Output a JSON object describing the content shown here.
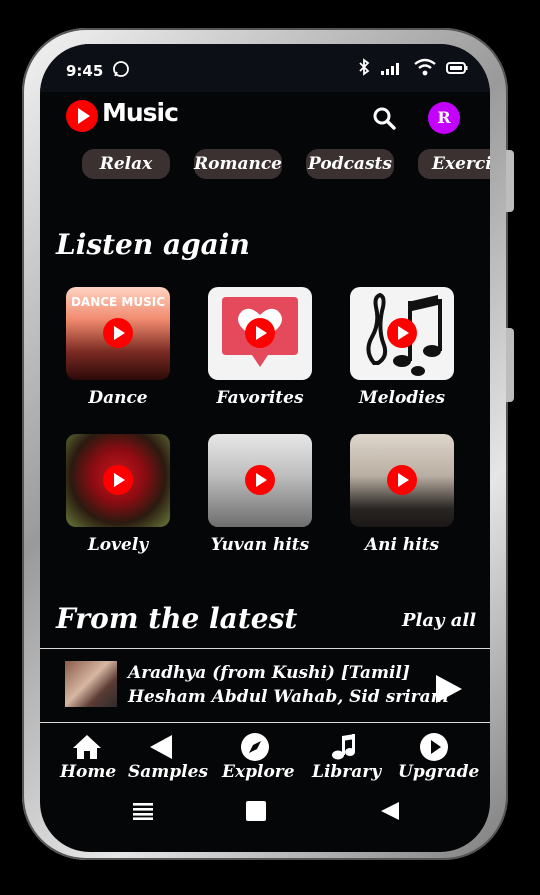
{
  "status": {
    "time": "9:45"
  },
  "app": {
    "title": "Music",
    "avatar_letter": "R"
  },
  "chips": [
    {
      "label": "Relax"
    },
    {
      "label": "Romance"
    },
    {
      "label": "Podcasts"
    },
    {
      "label": "Exercis"
    }
  ],
  "listen_again": {
    "title": "Listen again",
    "items": [
      {
        "label": "Dance",
        "art_text": "DANCE MUSIC"
      },
      {
        "label": "Favorites"
      },
      {
        "label": "Melodies"
      },
      {
        "label": "Lovely"
      },
      {
        "label": "Yuvan hits"
      },
      {
        "label": "Ani hits"
      }
    ]
  },
  "latest": {
    "title": "From the latest",
    "play_all": "Play all",
    "track": {
      "title": "Aradhya (from Kushi) [Tamil]",
      "artists": "Hesham Abdul Wahab, Sid sriram"
    }
  },
  "nav": [
    {
      "label": "Home",
      "icon": "home-icon"
    },
    {
      "label": "Samples",
      "icon": "back-arrow-icon"
    },
    {
      "label": "Explore",
      "icon": "compass-icon"
    },
    {
      "label": "Library",
      "icon": "music-note-icon"
    },
    {
      "label": "Upgrade",
      "icon": "play-circle-icon"
    }
  ],
  "colors": {
    "accent": "#ff0000",
    "avatar": "#c400ff",
    "chip": "#3b3130",
    "background": "#050608"
  }
}
